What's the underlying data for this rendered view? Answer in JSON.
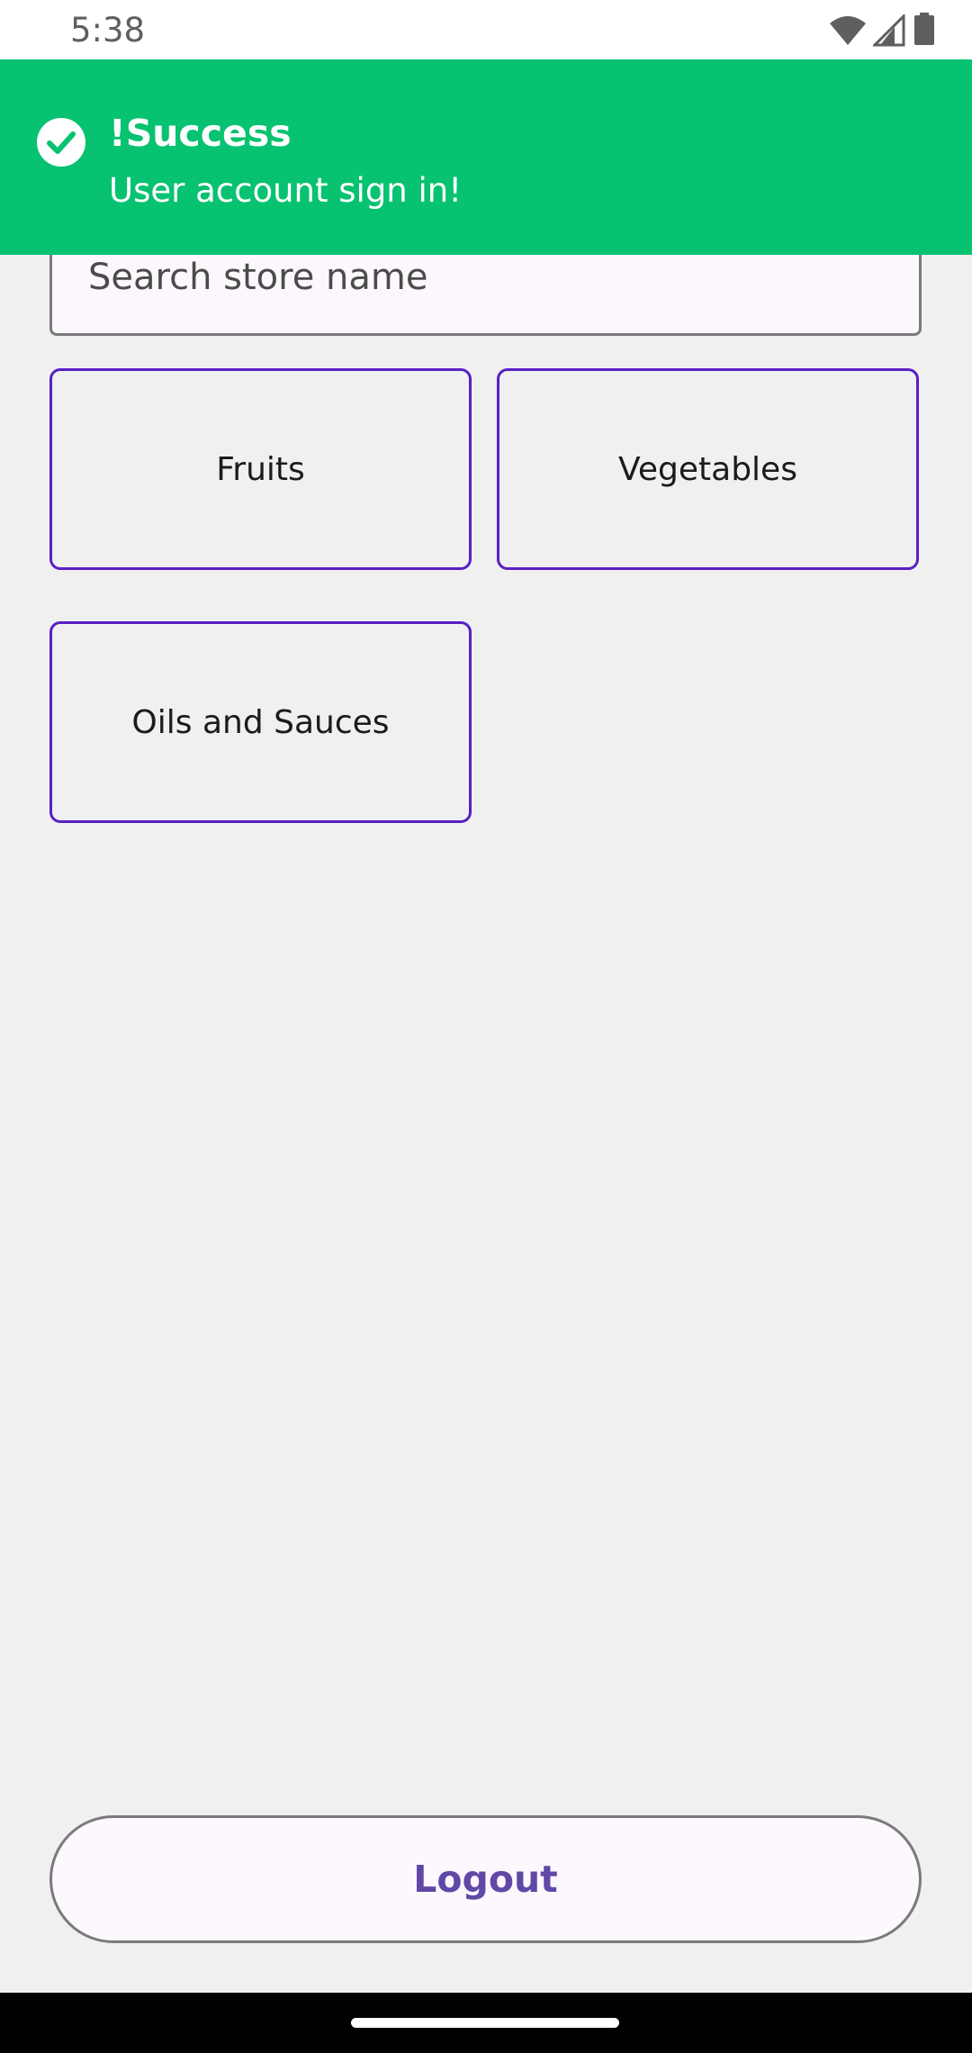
{
  "status_bar": {
    "time": "5:38",
    "icons": [
      "wifi-icon",
      "cell-signal-icon",
      "battery-icon"
    ]
  },
  "toast": {
    "icon": "check-circle-icon",
    "title": "!Success",
    "message": "User account sign in!",
    "color": "#07c270"
  },
  "search": {
    "placeholder": "Search store name",
    "value": ""
  },
  "categories": [
    {
      "label": "Fruits"
    },
    {
      "label": "Vegetables"
    },
    {
      "label": "Oils and Sauces"
    }
  ],
  "logout": {
    "label": "Logout"
  },
  "colors": {
    "accent": "#5a1fc4",
    "button_text": "#6148a7",
    "background": "#f0f0f0"
  }
}
